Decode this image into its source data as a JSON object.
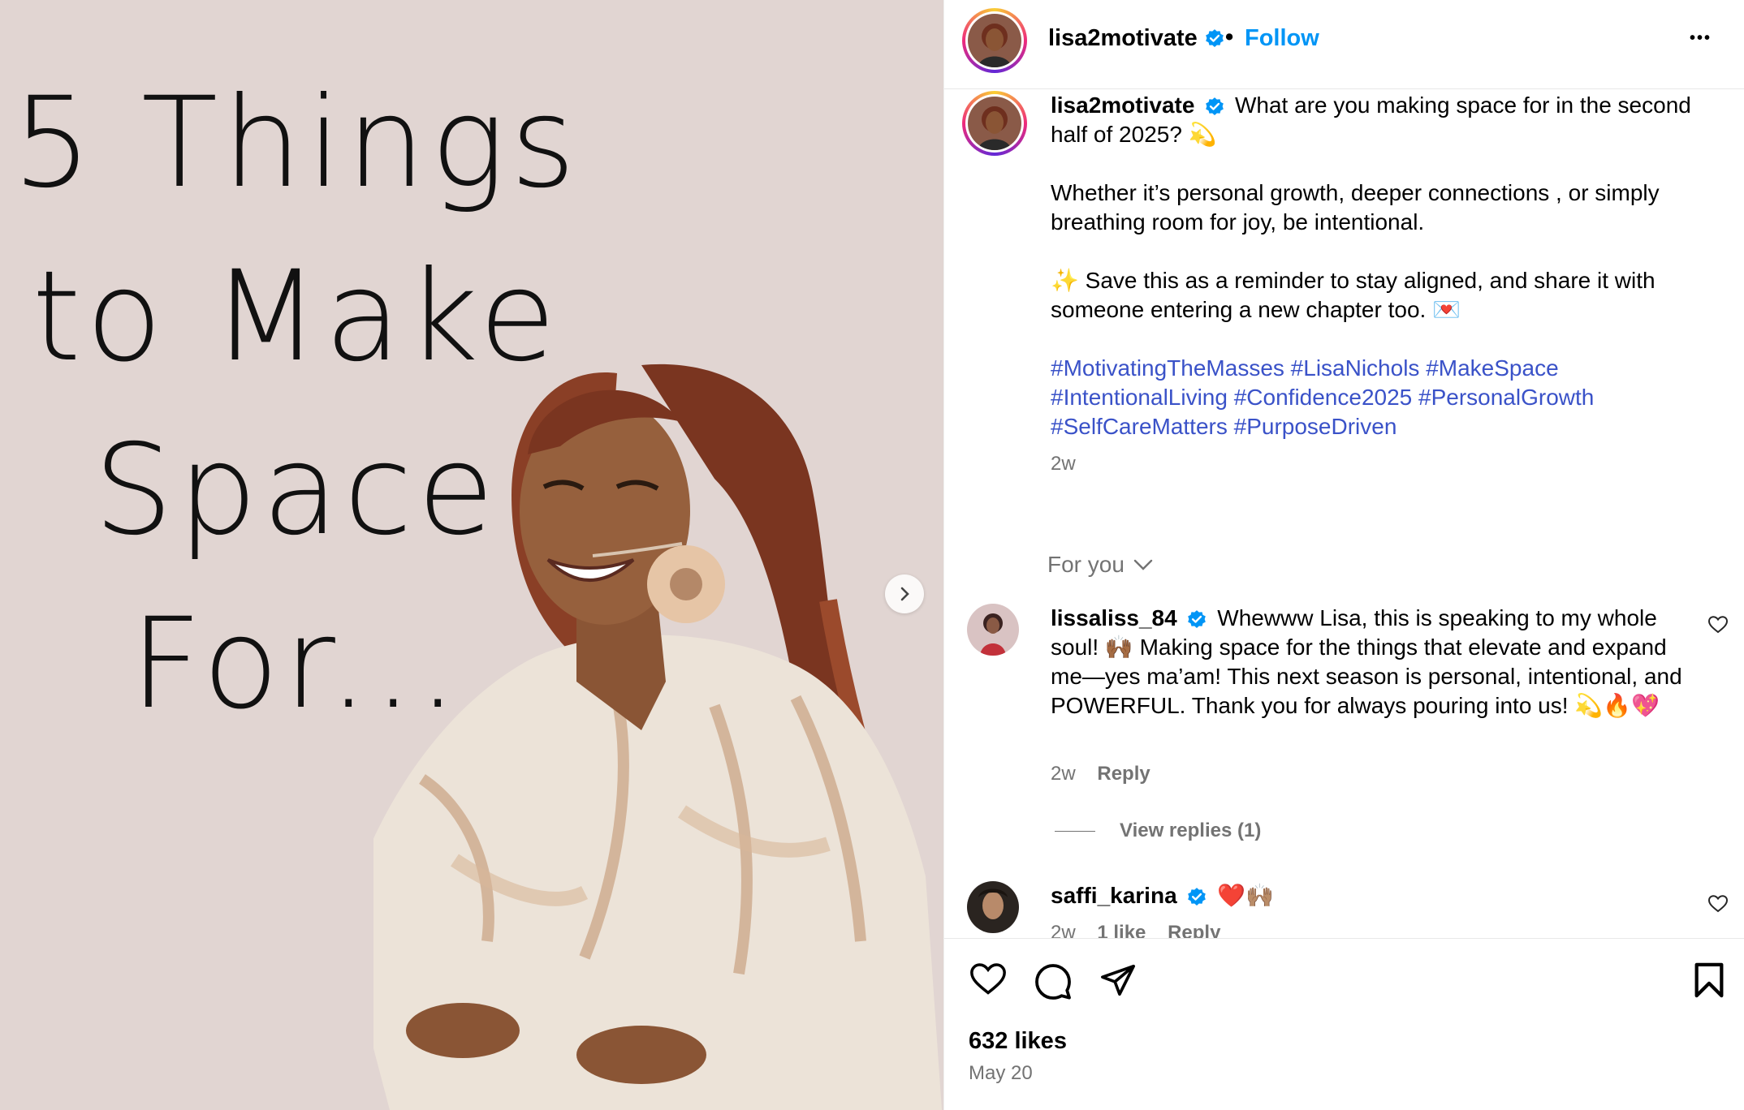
{
  "post_image": {
    "title_lines": [
      "5 Things",
      "to Make",
      "Space",
      "For..."
    ]
  },
  "header": {
    "username": "lisa2motivate",
    "separator": "•",
    "follow_label": "Follow",
    "more_label": "•••"
  },
  "caption": {
    "username": "lisa2motivate",
    "line1": "What are you making space for in the second half of 2025? 💫",
    "line2": "Whether it’s personal growth, deeper connections , or simply breathing room for joy, be intentional.",
    "line3": "✨ Save this as a reminder to stay aligned, and share it with someone entering a new chapter too. 💌",
    "hashtags": "#MotivatingTheMasses #LisaNichols #MakeSpace #IntentionalLiving #Confidence2025 #PersonalGrowth #SelfCareMatters #PurposeDriven",
    "time": "2w"
  },
  "for_you_label": "For you",
  "comments": [
    {
      "username": "lissaliss_84",
      "text": "Whewww Lisa, this is speaking to my whole soul! 🙌🏾 Making space for the things that elevate and expand me—yes ma’am! This next season is personal, intentional, and POWERFUL. Thank you for always pouring into us! 💫🔥💖",
      "time": "2w",
      "reply_label": "Reply",
      "view_replies": "View replies (1)"
    },
    {
      "username": "saffi_karina",
      "text": "❤️🙌🏽",
      "time": "2w",
      "likes": "1 like",
      "reply_label": "Reply"
    }
  ],
  "footer": {
    "likes": "632 likes",
    "date": "May 20"
  },
  "colors": {
    "accent": "#0095f6",
    "hashtag": "#3a52c8",
    "muted": "#737373",
    "media_bg": "#e1d5d2"
  }
}
